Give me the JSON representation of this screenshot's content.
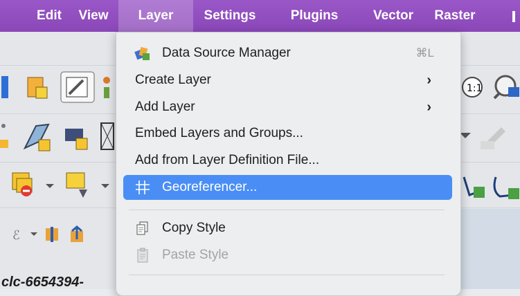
{
  "menubar": {
    "items": [
      {
        "label": "Edit"
      },
      {
        "label": "View"
      },
      {
        "label": "Layer"
      },
      {
        "label": "Settings"
      },
      {
        "label": "Plugins"
      },
      {
        "label": "Vector"
      },
      {
        "label": "Raster"
      }
    ],
    "active": "Layer"
  },
  "layer_menu": {
    "items": [
      {
        "label": "Data Source Manager",
        "shortcut": "⌘L",
        "icon": "data-source-manager-icon"
      },
      {
        "label": "Create Layer",
        "submenu": "›"
      },
      {
        "label": "Add Layer",
        "submenu": "›"
      },
      {
        "label": "Embed Layers and Groups..."
      },
      {
        "label": "Add from Layer Definition File..."
      },
      {
        "label": "Georeferencer...",
        "icon": "georeferencer-grid-icon",
        "highlighted": true
      },
      {
        "label": "Copy Style",
        "icon": "copy-style-icon"
      },
      {
        "label": "Paste Style",
        "icon": "paste-style-icon",
        "disabled": true
      }
    ]
  },
  "background": {
    "layer_name_fragment": "clc-6654394-"
  },
  "colors": {
    "menubar": "#8a47b8",
    "highlight": "#4a8ef5"
  }
}
